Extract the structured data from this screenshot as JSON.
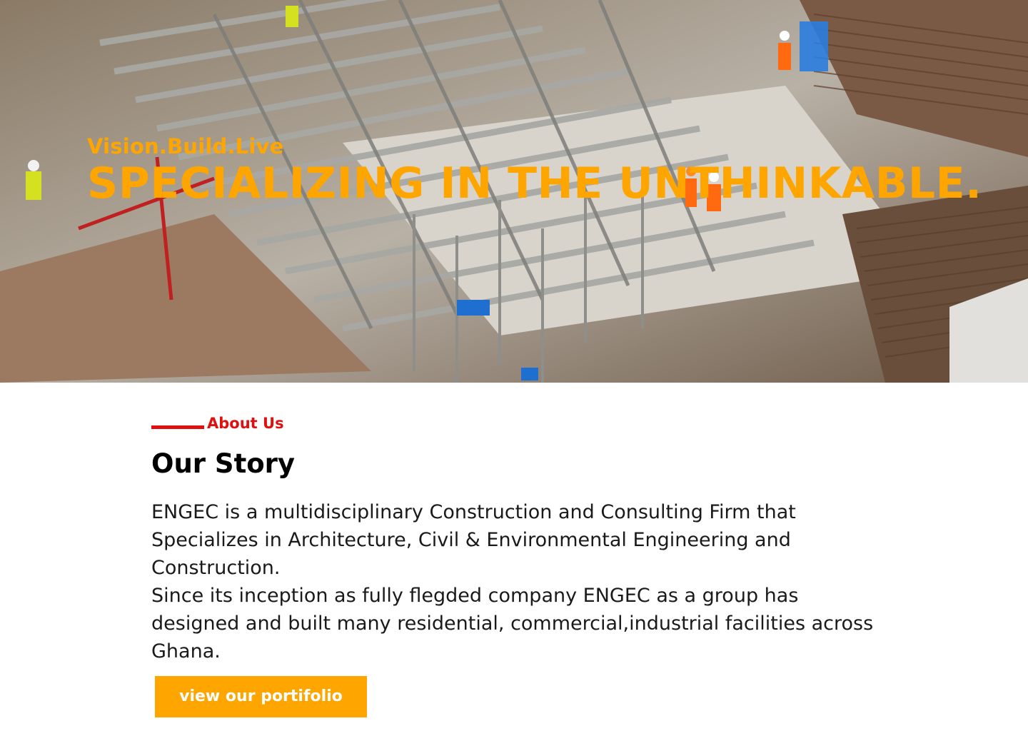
{
  "hero": {
    "tagline": "Vision.Build.Live",
    "headline": "SPECIALIZING IN THE UNTHINKABLE.",
    "image": "construction-site-aerial-photo"
  },
  "about": {
    "eyebrow": "About Us",
    "title": "Our Story",
    "paragraph_1": "ENGEC is a multidisciplinary Construction and Consulting Firm that Specializes in Architecture, Civil & Environmental Engineering and Construction.",
    "paragraph_2": "Since its inception as fully flegded company ENGEC as a group has designed and built many residential, commercial,industrial facilities across Ghana.",
    "cta_label": "view our portifolio"
  },
  "colors": {
    "accent": "#ffa500",
    "eyebrow_red": "#e01010",
    "text": "#1a1a1a"
  }
}
